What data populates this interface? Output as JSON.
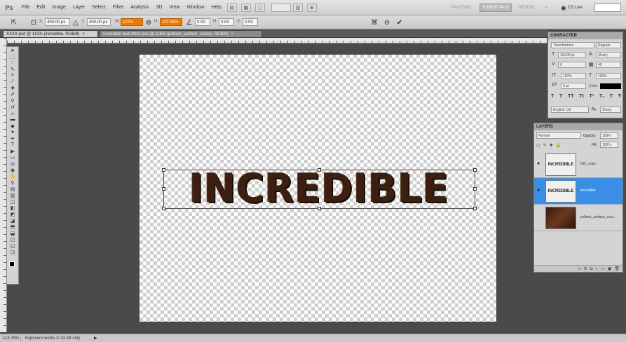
{
  "app": {
    "logo": "Ps"
  },
  "menubar": {
    "items": [
      "File",
      "Edit",
      "Image",
      "Layer",
      "Select",
      "Filter",
      "Analysis",
      "3D",
      "View",
      "Window",
      "Help"
    ],
    "workspaces": [
      "PAINTING",
      "ESSENTIALS",
      "DESIGN",
      "»"
    ],
    "cs_live": "CS Live"
  },
  "options": {
    "x": "400.00 px",
    "y": "300.00 px",
    "w": "107%",
    "h": "107.69%",
    "angle": "0.00",
    "h_skew": "0.00",
    "v_skew": "0.00"
  },
  "tabs": [
    {
      "label": "XXXX.psd @ 113% (incredible, RGB/8)",
      "active": true
    },
    {
      "label": "Incredible text effect.psd @ 116% (pollock_surface_cracks, RGB/8)",
      "active": false
    }
  ],
  "canvas": {
    "text": "INCREDIBLE"
  },
  "character_panel": {
    "title": "CHARACTER",
    "font_family": "Transformers",
    "font_style": "Regular",
    "size": "115.09 pt",
    "leading": "(Auto)",
    "kerning": "0",
    "tracking": "40",
    "vscale": "100%",
    "hscale": "100%",
    "baseline": "0 pt",
    "color_label": "Color:",
    "color": "#000000",
    "language": "English: UK",
    "aa": "Sharp"
  },
  "layers_panel": {
    "title": "LAYERS",
    "blend_mode": "Normal",
    "opacity_label": "Opacity:",
    "opacity": "100%",
    "fill_label": "Fill:",
    "fill": "100%",
    "layers": [
      {
        "thumb": "INCREDIBLE",
        "name": "INC_copy",
        "selected": false
      },
      {
        "thumb": "INCREDIBLE",
        "name": "incredible",
        "selected": true
      },
      {
        "thumb": "",
        "name": "pollock_surface_crac...",
        "selected": false
      }
    ]
  },
  "status": {
    "zoom": "113.25%",
    "info": "Exposure works in 32-bit only"
  }
}
